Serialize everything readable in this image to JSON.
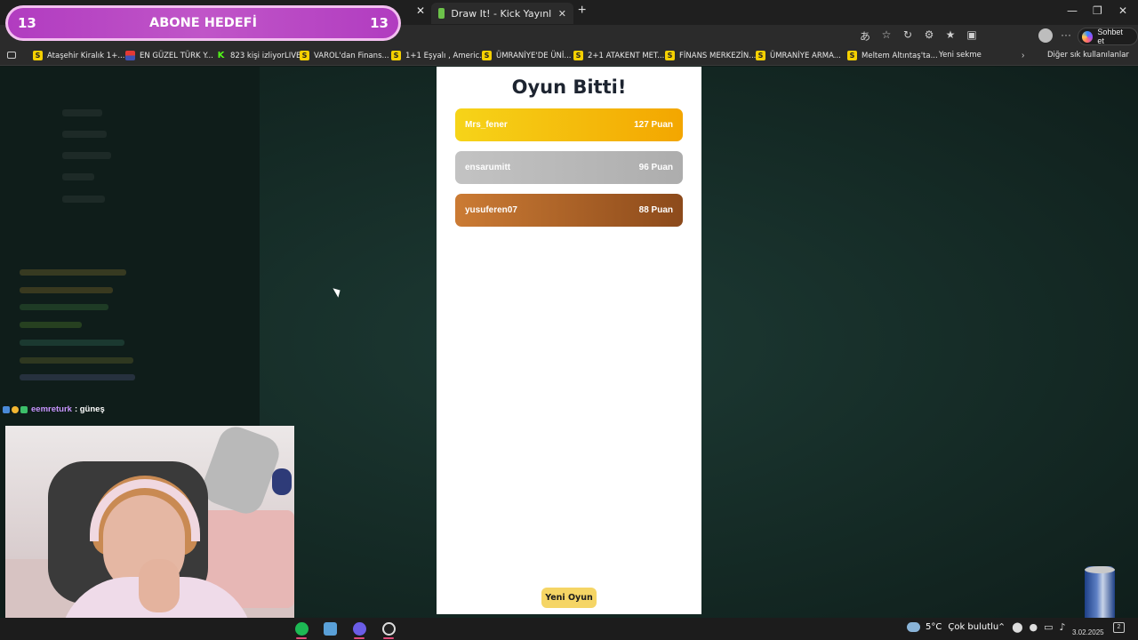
{
  "overlay": {
    "goal": {
      "left_count": "13",
      "title": "ABONE HEDEFİ",
      "right_count": "13"
    },
    "chat": [
      {
        "user": "eemreturk",
        "message": ": güneş"
      }
    ]
  },
  "browser": {
    "tabs": [
      {
        "title": "Draw It! - Kick Yayınları İçin Çizim",
        "active": true
      }
    ],
    "copilot_label": "Sohbet et",
    "bookmarks": [
      {
        "label": "Ataşehir Kiralık 1+...",
        "icon": "S"
      },
      {
        "label": "EN GÜZEL TÜRK Y...",
        "icon": "flag"
      },
      {
        "label": "823 kişi izliyorLIVE",
        "icon": "K"
      },
      {
        "label": "VAROL'dan Finans...",
        "icon": "S"
      },
      {
        "label": "1+1 Eşyalı , Americ...",
        "icon": "S"
      },
      {
        "label": "ÜMRANİYE'DE ÜNİ...",
        "icon": "S"
      },
      {
        "label": "2+1 ATAKENT MET...",
        "icon": "S"
      },
      {
        "label": "FİNANS MERKEZİN...",
        "icon": "S"
      },
      {
        "label": "ÜMRANİYE ARMA...",
        "icon": "S"
      },
      {
        "label": "Meltem Altıntaş'ta...",
        "icon": "S"
      },
      {
        "label": "Yeni sekme",
        "icon": "page"
      }
    ],
    "other_bookmarks": "Diğer sık kullanılanlar"
  },
  "game": {
    "title": "Oyun Bitti!",
    "leaderboard": [
      {
        "rank": 1,
        "name": "Mrs_fener",
        "score": "127 Puan",
        "color": "#f5c400"
      },
      {
        "rank": 2,
        "name": "ensarumitt",
        "score": "96 Puan",
        "color": "#b9b9b9"
      },
      {
        "rank": 3,
        "name": "yusuferen07",
        "score": "88 Puan",
        "color": "#a85a24"
      }
    ],
    "new_game_label": "Yeni Oyun"
  },
  "taskbar": {
    "apps": [
      "spotify-icon",
      "settings-app-icon",
      "discord-icon",
      "obs-icon"
    ],
    "weather_temp": "5°C",
    "weather_condition": "Çok bulutlu",
    "date": "3.02.2025",
    "notification_count": "2"
  }
}
